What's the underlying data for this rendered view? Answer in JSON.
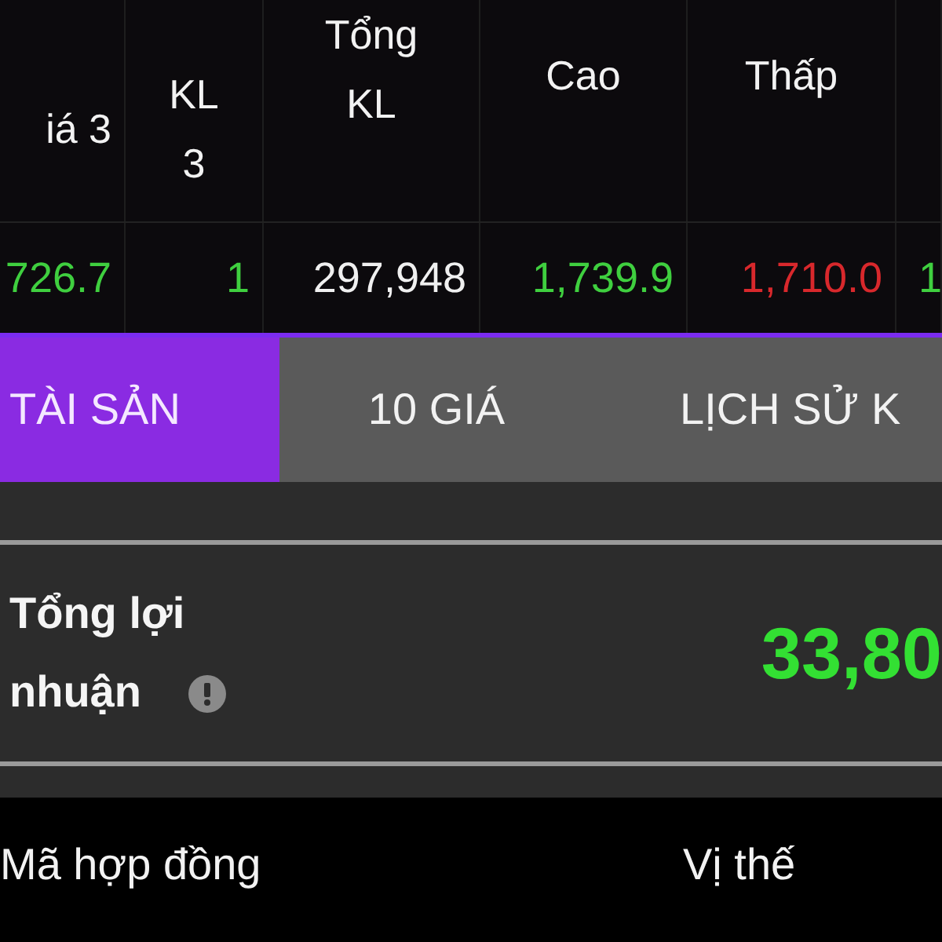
{
  "quote_table": {
    "columns": [
      {
        "label": "iá 3"
      },
      {
        "label": "KL 3"
      },
      {
        "label": "Tổng KL"
      },
      {
        "label": "Cao"
      },
      {
        "label": "Thấp"
      }
    ],
    "rows": [
      {
        "cells": [
          {
            "text": "726.7",
            "color": "#3fcf3f"
          },
          {
            "text": "1",
            "color": "#3fcf3f"
          },
          {
            "text": "297,948",
            "color": "#f0f0f0"
          },
          {
            "text": "1,739.9",
            "color": "#3fcf3f"
          },
          {
            "text": "1,710.0",
            "color": "#d8282c"
          },
          {
            "text": "1",
            "color": "#3fcf3f"
          }
        ]
      }
    ]
  },
  "tabs": [
    {
      "label": "TÀI SẢN",
      "selected": true
    },
    {
      "label": "10 GIÁ",
      "selected": false
    },
    {
      "label": "LỊCH SỬ K",
      "selected": false
    }
  ],
  "profit": {
    "label": "Tổng lợi nhuận",
    "value": "33,80"
  },
  "positions_table": {
    "columns": [
      {
        "label": "Mã hợp đồng"
      },
      {
        "label": "Vị thế"
      }
    ]
  }
}
